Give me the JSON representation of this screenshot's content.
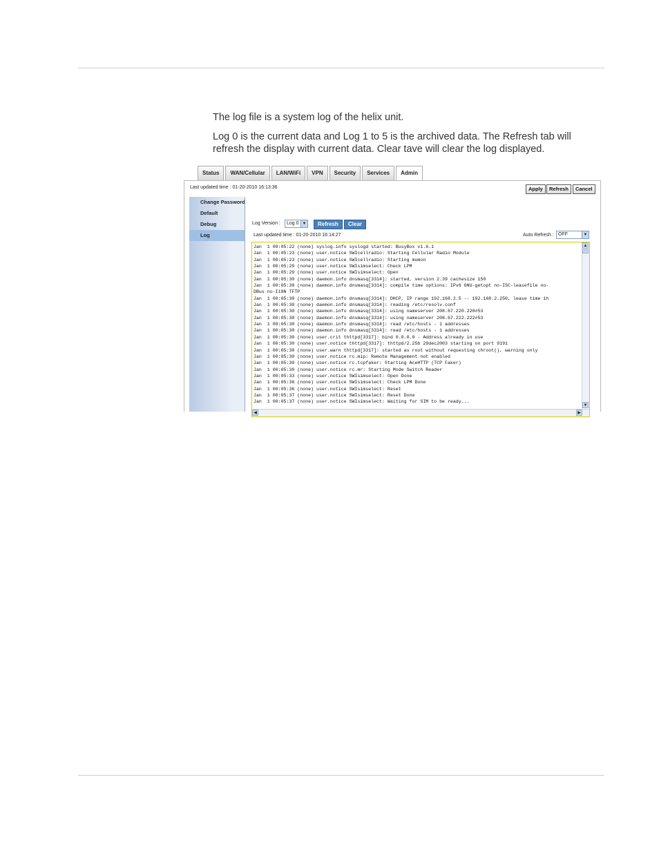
{
  "doc": {
    "paragraphs": [
      "The log file is a system log of the helix unit.",
      "Log 0 is the current data and Log 1 to 5 is the archived data. The Refresh tab will refresh the display with current data. Clear tave will clear the log displayed."
    ]
  },
  "tabs": [
    "Status",
    "WAN/Cellular",
    "LAN/WiFi",
    "VPN",
    "Security",
    "Services",
    "Admin"
  ],
  "active_tab": "Admin",
  "header": {
    "last_updated": "Last updated time : 01-20-2010 16:13:36",
    "apply": "Apply",
    "refresh": "Refresh",
    "cancel": "Cancel"
  },
  "sidebar": {
    "items": [
      "Change Password",
      "Default",
      "Debug",
      "Log"
    ],
    "active": "Log"
  },
  "log_panel": {
    "version_label": "Log Version :",
    "version_value": "Log 0",
    "refresh": "Refresh",
    "clear": "Clear",
    "last_updated": "Last updated time :  01-20-2010 16:14:27",
    "auto_refresh_label": "Auto Refresh :",
    "auto_refresh_value": "OFF",
    "lines": [
      "Jan  1 00:05:22 (none) syslog.info syslogd started: BusyBox v1.6.1",
      "Jan  1 00:05:23 (none) user.notice SWIcellradio: Starting Cellular Radio Module",
      "Jan  1 00:05:23 (none) user.notice SWIcellradio: Starting mumon",
      "Jan  1 00:05:29 (none) user.notice SWIsimselect: Check LPM",
      "Jan  1 00:05:29 (none) user.notice SWIsimselect: Open",
      "Jan  1 00:05:30 (none) daemon.info dnsmasq[3314]: started, version 2.39 cachesize 150",
      "Jan  1 00:05:30 (none) daemon.info dnsmasq[3314]: compile time options: IPv6 GNU-getopt no-ISC-leasefile no-",
      "DBus no-I18N TFTP",
      "Jan  1 00:05:30 (none) daemon.info dnsmasq[3314]: DHCP, IP range 192.168.2.5 -- 192.168.2.250, lease time 1h",
      "Jan  1 00:05:30 (none) daemon.info dnsmasq[3314]: reading /etc/resolv.conf",
      "Jan  1 00:05:30 (none) daemon.info dnsmasq[3314]: using nameserver 208.67.220.220#53",
      "Jan  1 00:05:30 (none) daemon.info dnsmasq[3314]: using nameserver 208.67.222.222#53",
      "Jan  1 00:05:30 (none) daemon.info dnsmasq[3314]: read /etc/hosts - 1 addresses",
      "Jan  1 00:05:30 (none) daemon.info dnsmasq[3314]: read /etc/hosts - 1 addresses",
      "Jan  1 00:05:30 (none) user.crit thttpd[3317]: bind 0.0.0.0 - Address already in use",
      "Jan  1 00:05:30 (none) user.notice thttpd[3317]: thttpd/2.25b 29dec2003 starting on port 9191",
      "Jan  1 00:05:30 (none) user.warn thttpd[3317]: started as root without requesting chroot(), warning only",
      "Jan  1 00:05:30 (none) user.notice rc.mip: Remote Management not enabled",
      "Jan  1 00:05:30 (none) user.notice rc.tcpfaker: Starting AceHTTP (TCP Faker)",
      "Jan  1 00:05:30 (none) user.notice rc.mr: Starting Mode Switch Reader",
      "Jan  1 00:05:33 (none) user.notice SWIsimselect: Open Done",
      "Jan  1 00:05:36 (none) user.notice SWIsimselect: Check LPM Done",
      "Jan  1 00:05:36 (none) user.notice SWIsimselect: Reset",
      "Jan  1 00:05:37 (none) user.notice SWIsimselect: Reset Done",
      "Jan  1 00:05:37 (none) user.notice SWIsimselect: Waiting for SIM to be ready..."
    ]
  },
  "icons": {
    "dropdown": "chevron-down-icon",
    "scroll_up": "scroll-up-icon",
    "scroll_down": "scroll-down-icon",
    "scroll_left": "scroll-left-icon",
    "scroll_right": "scroll-right-icon"
  },
  "colors": {
    "accent_button": "#4b80b8",
    "sidebar_active": "#9ec0e4",
    "log_border": "#cfcf00"
  }
}
